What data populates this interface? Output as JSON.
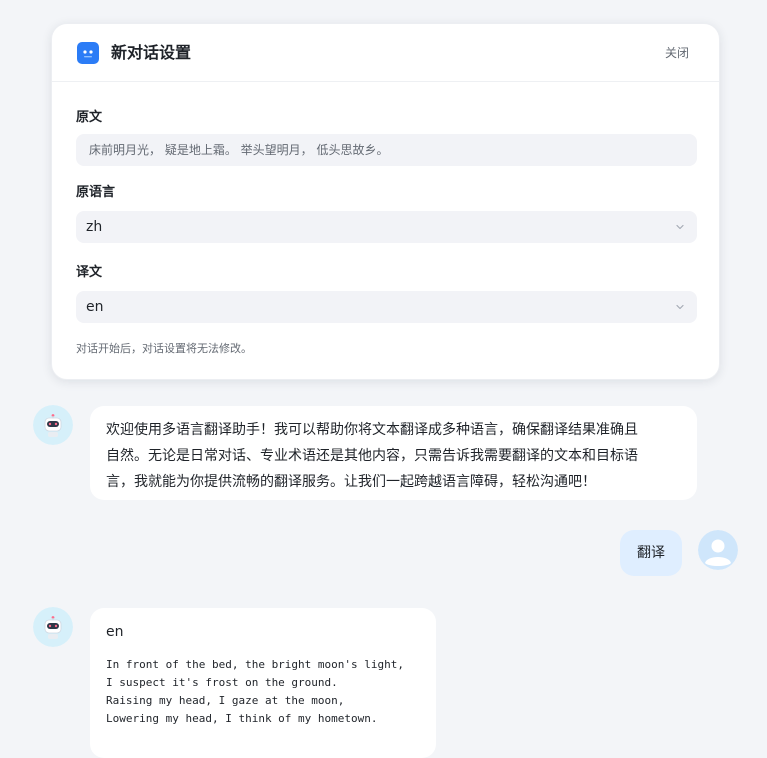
{
  "settings": {
    "title": "新对话设置",
    "close_label": "关闭",
    "source_text_label": "原文",
    "source_text_value": "床前明月光， 疑是地上霜。 举头望明月， 低头思故乡。",
    "source_lang_label": "原语言",
    "source_lang_value": "zh",
    "target_lang_label": "译文",
    "target_lang_value": "en",
    "hint": "对话开始后，对话设置将无法修改。",
    "icons": {
      "bot": "bot-icon",
      "chevron": "chevron-down-icon"
    }
  },
  "chat": {
    "welcome": {
      "line1": "欢迎使用多语言翻译助手！我可以帮助你将文本翻译成多种语言，确保翻译结果准确且",
      "line2": "自然。无论是日常对话、专业术语还是其他内容，只需告诉我需要翻译的文本和目标语",
      "line3": "言，我就能为你提供流畅的翻译服务。让我们一起跨越语言障碍，轻松沟通吧！"
    },
    "user_message": "翻译",
    "result": {
      "language": "en",
      "lines": [
        "In front of the bed, the bright moon's light,",
        "I suspect it's frost on the ground.",
        "Raising my head, I gaze at the moon,",
        "Lowering my head, I think of my hometown."
      ]
    },
    "avatars": {
      "bot": "robot-avatar",
      "user": "user-avatar"
    }
  },
  "colors": {
    "background": "#f3f5f8",
    "accent": "#2b7cf6",
    "user_bubble": "#dfeeff",
    "field_bg": "#f2f3f7"
  }
}
